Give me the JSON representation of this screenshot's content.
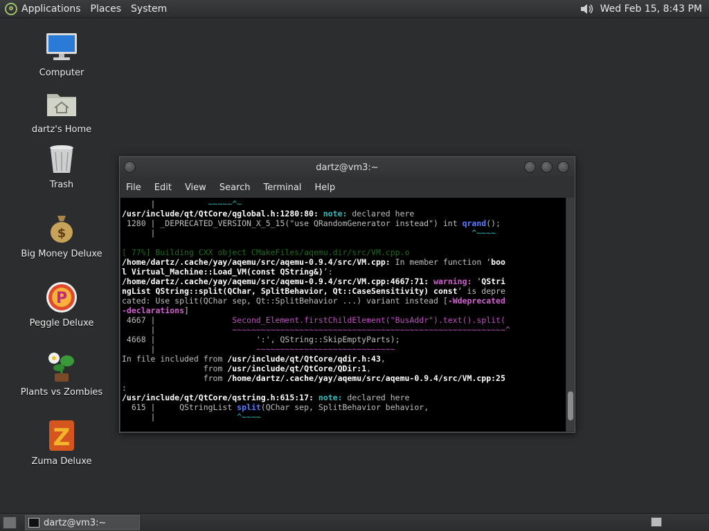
{
  "top_panel": {
    "menus": [
      "Applications",
      "Places",
      "System"
    ],
    "clock": "Wed Feb 15,  8:43 PM",
    "icons": {
      "logo": "distro-logo-icon",
      "volume": "volume-icon"
    }
  },
  "desktop": {
    "icons": [
      {
        "label": "Computer",
        "icon": "computer-icon"
      },
      {
        "label": "dartz's Home",
        "icon": "home-folder-icon"
      },
      {
        "label": "Trash",
        "icon": "trash-icon"
      },
      {
        "label": "Big Money Deluxe",
        "icon": "money-bag-icon"
      },
      {
        "label": "Peggle Deluxe",
        "icon": "peggle-icon"
      },
      {
        "label": "Plants vs Zombies",
        "icon": "plants-icon"
      },
      {
        "label": "Zuma Deluxe",
        "icon": "zuma-icon"
      }
    ]
  },
  "terminal": {
    "title": "dartz@vm3:~",
    "menu": [
      "File",
      "Edit",
      "View",
      "Search",
      "Terminal",
      "Help"
    ]
  },
  "taskbar": {
    "task_label": "dartz@vm3:~"
  },
  "colors": {
    "desktop_bg": "#2b2d2e",
    "terminal_bg": "#000000",
    "accent_cyan": "#2ec0c0",
    "accent_magenta": "#c050c0"
  }
}
